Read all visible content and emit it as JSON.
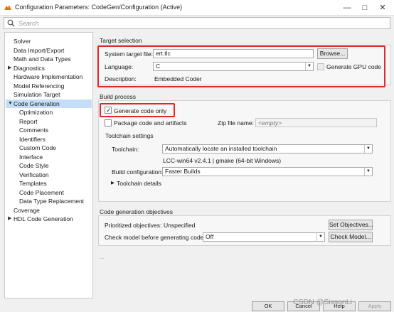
{
  "window": {
    "title": "Configuration Parameters: CodeGen/Configuration (Active)",
    "minimize_icon": "minimize-icon",
    "maximize_icon": "maximize-icon",
    "close_icon": "close-icon"
  },
  "search": {
    "placeholder": "Search"
  },
  "tree": {
    "items": [
      {
        "label": "Solver",
        "level": 0,
        "expandable": false,
        "selected": false
      },
      {
        "label": "Data Import/Export",
        "level": 0,
        "expandable": false,
        "selected": false
      },
      {
        "label": "Math and Data Types",
        "level": 0,
        "expandable": false,
        "selected": false
      },
      {
        "label": "Diagnostics",
        "level": 0,
        "expandable": true,
        "expanded": false,
        "selected": false
      },
      {
        "label": "Hardware Implementation",
        "level": 0,
        "expandable": false,
        "selected": false
      },
      {
        "label": "Model Referencing",
        "level": 0,
        "expandable": false,
        "selected": false
      },
      {
        "label": "Simulation Target",
        "level": 0,
        "expandable": false,
        "selected": false
      },
      {
        "label": "Code Generation",
        "level": 0,
        "expandable": true,
        "expanded": true,
        "selected": true
      },
      {
        "label": "Optimization",
        "level": 1,
        "expandable": false,
        "selected": false
      },
      {
        "label": "Report",
        "level": 1,
        "expandable": false,
        "selected": false
      },
      {
        "label": "Comments",
        "level": 1,
        "expandable": false,
        "selected": false
      },
      {
        "label": "Identifiers",
        "level": 1,
        "expandable": false,
        "selected": false
      },
      {
        "label": "Custom Code",
        "level": 1,
        "expandable": false,
        "selected": false
      },
      {
        "label": "Interface",
        "level": 1,
        "expandable": false,
        "selected": false
      },
      {
        "label": "Code Style",
        "level": 1,
        "expandable": false,
        "selected": false
      },
      {
        "label": "Verification",
        "level": 1,
        "expandable": false,
        "selected": false
      },
      {
        "label": "Templates",
        "level": 1,
        "expandable": false,
        "selected": false
      },
      {
        "label": "Code Placement",
        "level": 1,
        "expandable": false,
        "selected": false
      },
      {
        "label": "Data Type Replacement",
        "level": 1,
        "expandable": false,
        "selected": false
      },
      {
        "label": "Coverage",
        "level": 0,
        "expandable": false,
        "selected": false
      },
      {
        "label": "HDL Code Generation",
        "level": 0,
        "expandable": true,
        "expanded": false,
        "selected": false
      }
    ]
  },
  "target_selection": {
    "title": "Target selection",
    "system_target_file_label": "System target file:",
    "system_target_file_value": "ert.tlc",
    "browse_label": "Browse...",
    "language_label": "Language:",
    "language_value": "C",
    "gpu_label": "Generate GPU code",
    "gpu_checked": false,
    "description_label": "Description:",
    "description_value": "Embedded Coder"
  },
  "build_process": {
    "title": "Build process",
    "generate_code_only_label": "Generate code only",
    "generate_code_only_checked": true,
    "package_label": "Package code and artifacts",
    "package_checked": false,
    "zip_label": "Zip file name:",
    "zip_placeholder": "<empty>",
    "toolchain_settings_title": "Toolchain settings",
    "toolchain_label": "Toolchain:",
    "toolchain_value": "Automatically locate an installed toolchain",
    "toolchain_info": "LCC-win64 v2.4.1 | gmake (64-bit Windows)",
    "build_config_label": "Build configuration:",
    "build_config_value": "Faster Builds",
    "toolchain_details_label": "Toolchain details"
  },
  "objectives": {
    "title": "Code generation objectives",
    "prioritized_label": "Prioritized objectives:",
    "prioritized_value": "Unspecified",
    "set_objectives_label": "Set Objectives...",
    "check_model_label": "Check model before generating code:",
    "check_model_value": "Off",
    "check_model_button_label": "Check Model..."
  },
  "ellipsis": "...",
  "bottom": {
    "ok_label": "OK",
    "cancel_label": "Cancel",
    "help_label": "Help",
    "apply_label": "Apply"
  },
  "watermark": "CSDN @SissonLi",
  "colors": {
    "highlight_red": "#e4262a",
    "selection_blue": "#c5def7",
    "app_icon_orange": "#e07a1f"
  }
}
